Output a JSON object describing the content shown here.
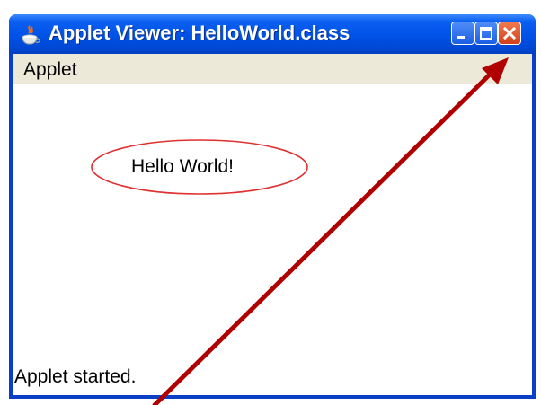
{
  "window": {
    "title": "Applet Viewer: HelloWorld.class",
    "icon": "java-cup-icon",
    "controls": {
      "minimize": "minimize-icon",
      "maximize": "maximize-icon",
      "close": "close-icon"
    }
  },
  "menubar": {
    "items": [
      {
        "label": "Applet"
      }
    ]
  },
  "applet": {
    "greeting": "Hello World!",
    "ellipse_color": "#e03030"
  },
  "status": {
    "text": "Applet started."
  },
  "annotation": {
    "arrow_color": "#b00000",
    "points_to": "close-button"
  }
}
